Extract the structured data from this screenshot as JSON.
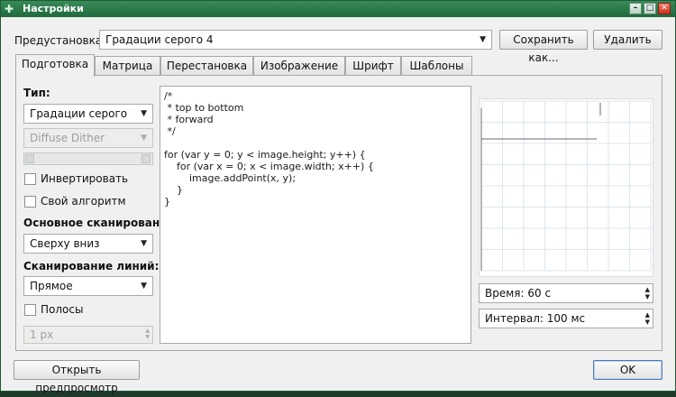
{
  "window": {
    "title": "Настройки"
  },
  "preset": {
    "label": "Предустановка:",
    "value": "Градации серого 4",
    "save_label": "Сохранить как...",
    "delete_label": "Удалить"
  },
  "tabs": [
    {
      "label": "Подготовка"
    },
    {
      "label": "Матрица"
    },
    {
      "label": "Перестановка"
    },
    {
      "label": "Изображение"
    },
    {
      "label": "Шрифт"
    },
    {
      "label": "Шаблоны"
    }
  ],
  "left": {
    "type_label": "Тип:",
    "type_value": "Градации серого",
    "dither_value": "Diffuse Dither",
    "invert_label": "Инвертировать",
    "custom_algo_label": "Свой алгоритм",
    "main_scan_label": "Основное сканирование:",
    "main_scan_value": "Сверху вниз",
    "line_scan_label": "Сканирование линий:",
    "line_scan_value": "Прямое",
    "stripes_label": "Полосы",
    "stripe_width": "1 px"
  },
  "editor": {
    "code": "/*\n * top to bottom\n * forward\n */\n\nfor (var y = 0; y < image.height; y++) {\n    for (var x = 0; x < image.width; x++) {\n        image.addPoint(x, y);\n    }\n}"
  },
  "right": {
    "time_value": "Время: 60 с",
    "interval_value": "Интервал: 100 мс"
  },
  "footer": {
    "preview_label": "Открыть предпросмотр",
    "ok_label": "OK"
  }
}
